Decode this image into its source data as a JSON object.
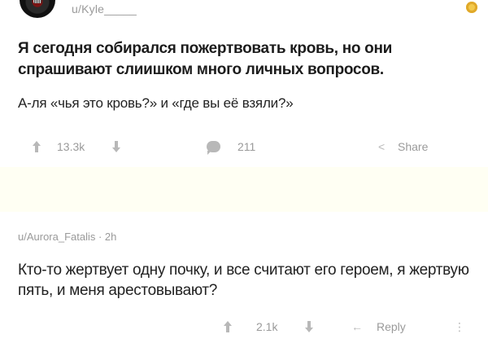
{
  "post": {
    "username": "u/Kyle_____",
    "title": "Я сегодня собирался пожертвовать кровь, но они спрашивают слиишком много личных вопросов.",
    "body": "А-ля «чья это кровь?» и «где вы её взяли?»",
    "actions": {
      "votes": "13.3k",
      "comments": "211",
      "share": "Share"
    },
    "icons": [
      "avatar",
      "award-icon",
      "upvote-icon",
      "downvote-icon",
      "comment-bubble-icon",
      "share-icon"
    ]
  },
  "comment": {
    "meta": "u/Aurora_Fatalis · 2h",
    "text": "Кто-то жертвует одну почку, и все считают его героем, я жертвую пять, и меня арестовывают?",
    "actions": {
      "votes": "2.1k",
      "reply": "Reply"
    },
    "icons": [
      "upvote-icon",
      "downvote-icon",
      "reply-arrow-icon",
      "more-dots-icon"
    ]
  },
  "colors": {
    "meta_gray": "#9a9a9a",
    "band": "#fffff3",
    "award": "#f3c94b"
  }
}
